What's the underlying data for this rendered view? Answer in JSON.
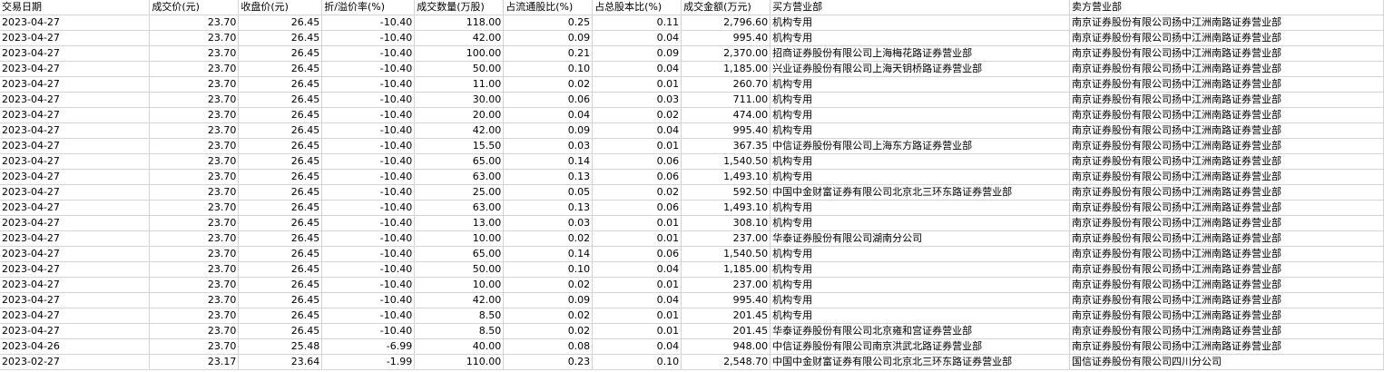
{
  "table": {
    "columns": [
      "交易日期",
      "成交价(元)",
      "收盘价(元)",
      "折/溢价率(%)",
      "成交数量(万股)",
      "占流通股比(%)",
      "占总股本比(%)",
      "成交金额(万元)",
      "买方营业部",
      "卖方营业部"
    ],
    "rows": [
      [
        "2023-04-27",
        "23.70",
        "26.45",
        "-10.40",
        "118.00",
        "0.25",
        "0.11",
        "2,796.60",
        "机构专用",
        "南京证券股份有限公司扬中江洲南路证券营业部"
      ],
      [
        "2023-04-27",
        "23.70",
        "26.45",
        "-10.40",
        "42.00",
        "0.09",
        "0.04",
        "995.40",
        "机构专用",
        "南京证券股份有限公司扬中江洲南路证券营业部"
      ],
      [
        "2023-04-27",
        "23.70",
        "26.45",
        "-10.40",
        "100.00",
        "0.21",
        "0.09",
        "2,370.00",
        "招商证券股份有限公司上海梅花路证券营业部",
        "南京证券股份有限公司扬中江洲南路证券营业部"
      ],
      [
        "2023-04-27",
        "23.70",
        "26.45",
        "-10.40",
        "50.00",
        "0.10",
        "0.04",
        "1,185.00",
        "兴业证券股份有限公司上海天钥桥路证券营业部",
        "南京证券股份有限公司扬中江洲南路证券营业部"
      ],
      [
        "2023-04-27",
        "23.70",
        "26.45",
        "-10.40",
        "11.00",
        "0.02",
        "0.01",
        "260.70",
        "机构专用",
        "南京证券股份有限公司扬中江洲南路证券营业部"
      ],
      [
        "2023-04-27",
        "23.70",
        "26.45",
        "-10.40",
        "30.00",
        "0.06",
        "0.03",
        "711.00",
        "机构专用",
        "南京证券股份有限公司扬中江洲南路证券营业部"
      ],
      [
        "2023-04-27",
        "23.70",
        "26.45",
        "-10.40",
        "20.00",
        "0.04",
        "0.02",
        "474.00",
        "机构专用",
        "南京证券股份有限公司扬中江洲南路证券营业部"
      ],
      [
        "2023-04-27",
        "23.70",
        "26.45",
        "-10.40",
        "42.00",
        "0.09",
        "0.04",
        "995.40",
        "机构专用",
        "南京证券股份有限公司扬中江洲南路证券营业部"
      ],
      [
        "2023-04-27",
        "23.70",
        "26.45",
        "-10.40",
        "15.50",
        "0.03",
        "0.01",
        "367.35",
        "中信证券股份有限公司上海东方路证券营业部",
        "南京证券股份有限公司扬中江洲南路证券营业部"
      ],
      [
        "2023-04-27",
        "23.70",
        "26.45",
        "-10.40",
        "65.00",
        "0.14",
        "0.06",
        "1,540.50",
        "机构专用",
        "南京证券股份有限公司扬中江洲南路证券营业部"
      ],
      [
        "2023-04-27",
        "23.70",
        "26.45",
        "-10.40",
        "63.00",
        "0.13",
        "0.06",
        "1,493.10",
        "机构专用",
        "南京证券股份有限公司扬中江洲南路证券营业部"
      ],
      [
        "2023-04-27",
        "23.70",
        "26.45",
        "-10.40",
        "25.00",
        "0.05",
        "0.02",
        "592.50",
        "中国中金财富证券有限公司北京北三环东路证券营业部",
        "南京证券股份有限公司扬中江洲南路证券营业部"
      ],
      [
        "2023-04-27",
        "23.70",
        "26.45",
        "-10.40",
        "63.00",
        "0.13",
        "0.06",
        "1,493.10",
        "机构专用",
        "南京证券股份有限公司扬中江洲南路证券营业部"
      ],
      [
        "2023-04-27",
        "23.70",
        "26.45",
        "-10.40",
        "13.00",
        "0.03",
        "0.01",
        "308.10",
        "机构专用",
        "南京证券股份有限公司扬中江洲南路证券营业部"
      ],
      [
        "2023-04-27",
        "23.70",
        "26.45",
        "-10.40",
        "10.00",
        "0.02",
        "0.01",
        "237.00",
        "华泰证券股份有限公司湖南分公司",
        "南京证券股份有限公司扬中江洲南路证券营业部"
      ],
      [
        "2023-04-27",
        "23.70",
        "26.45",
        "-10.40",
        "65.00",
        "0.14",
        "0.06",
        "1,540.50",
        "机构专用",
        "南京证券股份有限公司扬中江洲南路证券营业部"
      ],
      [
        "2023-04-27",
        "23.70",
        "26.45",
        "-10.40",
        "50.00",
        "0.10",
        "0.04",
        "1,185.00",
        "机构专用",
        "南京证券股份有限公司扬中江洲南路证券营业部"
      ],
      [
        "2023-04-27",
        "23.70",
        "26.45",
        "-10.40",
        "10.00",
        "0.02",
        "0.01",
        "237.00",
        "机构专用",
        "南京证券股份有限公司扬中江洲南路证券营业部"
      ],
      [
        "2023-04-27",
        "23.70",
        "26.45",
        "-10.40",
        "42.00",
        "0.09",
        "0.04",
        "995.40",
        "机构专用",
        "南京证券股份有限公司扬中江洲南路证券营业部"
      ],
      [
        "2023-04-27",
        "23.70",
        "26.45",
        "-10.40",
        "8.50",
        "0.02",
        "0.01",
        "201.45",
        "机构专用",
        "南京证券股份有限公司扬中江洲南路证券营业部"
      ],
      [
        "2023-04-27",
        "23.70",
        "26.45",
        "-10.40",
        "8.50",
        "0.02",
        "0.01",
        "201.45",
        "华泰证券股份有限公司北京雍和宫证券营业部",
        "南京证券股份有限公司扬中江洲南路证券营业部"
      ],
      [
        "2023-04-26",
        "23.70",
        "25.48",
        "-6.99",
        "40.00",
        "0.08",
        "0.04",
        "948.00",
        "中信证券股份有限公司南京洪武北路证券营业部",
        "南京证券股份有限公司扬中江洲南路证券营业部"
      ],
      [
        "2023-02-27",
        "23.17",
        "23.64",
        "-1.99",
        "110.00",
        "0.23",
        "0.10",
        "2,548.70",
        "中国中金财富证券有限公司北京北三环东路证券营业部",
        "国信证券股份有限公司四川分公司"
      ]
    ]
  }
}
